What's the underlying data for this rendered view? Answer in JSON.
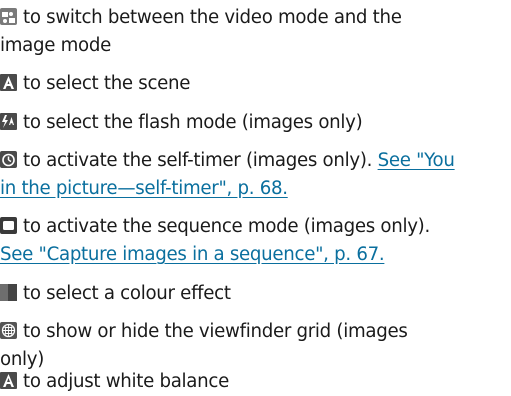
{
  "entries": [
    {
      "icon": "video-image-mode-icon",
      "line1": "to switch between the video mode and the",
      "line2": "image mode"
    },
    {
      "icon": "scene-icon",
      "line1": "to select the scene"
    },
    {
      "icon": "flash-icon",
      "line1": "to select the flash mode (images only)"
    },
    {
      "icon": "self-timer-icon",
      "line1": "to activate the self-timer (images only).",
      "link1a": "See \"You",
      "link1b": "in the picture—self-timer\", p. 68."
    },
    {
      "icon": "sequence-mode-icon",
      "line1": "to activate the sequence mode (images only).",
      "link": "See \"Capture images in a sequence\", p. 67."
    },
    {
      "icon": "colour-effect-icon",
      "line1": "to select a colour effect"
    },
    {
      "icon": "viewfinder-grid-icon",
      "line1": "to show or hide the viewfinder grid (images",
      "line2": "only)"
    },
    {
      "icon": "white-balance-icon",
      "line1": "to adjust white balance"
    }
  ]
}
